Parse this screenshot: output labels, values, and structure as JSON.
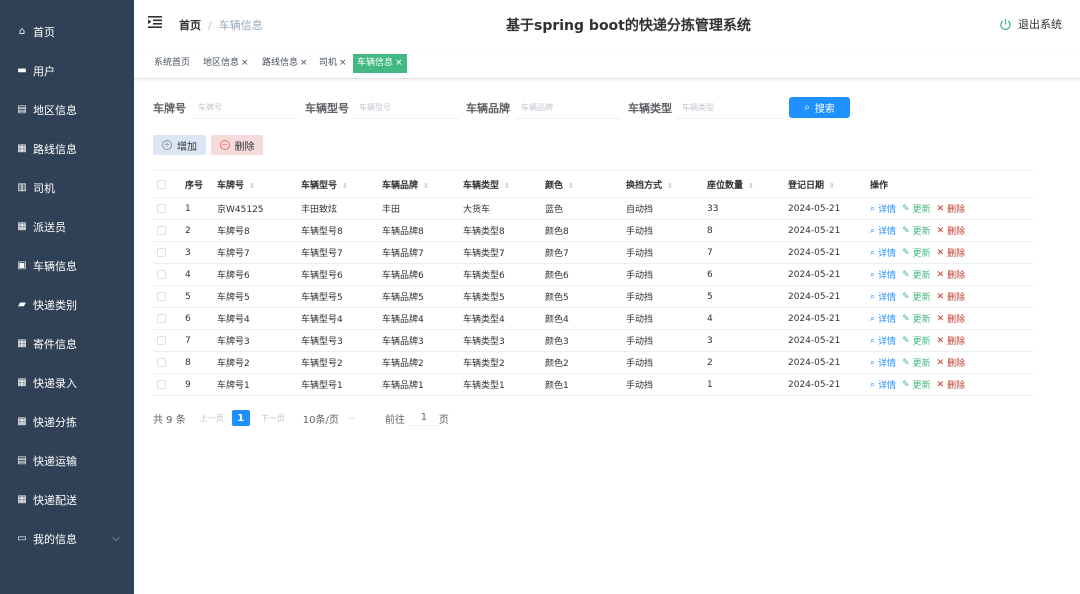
{
  "sidebar": {
    "items": [
      {
        "label": "首页",
        "icon": "home-icon",
        "glyph": "⌂"
      },
      {
        "label": "用户",
        "icon": "chat-icon",
        "glyph": "▬"
      },
      {
        "label": "地区信息",
        "icon": "clipboard-icon",
        "glyph": "▤"
      },
      {
        "label": "路线信息",
        "icon": "grid-icon",
        "glyph": "▦"
      },
      {
        "label": "司机",
        "icon": "table-icon",
        "glyph": "▥"
      },
      {
        "label": "派送员",
        "icon": "grid-icon",
        "glyph": "▦"
      },
      {
        "label": "车辆信息",
        "icon": "calendar-icon",
        "glyph": "▣"
      },
      {
        "label": "快递类别",
        "icon": "briefcase-icon",
        "glyph": "▰"
      },
      {
        "label": "寄件信息",
        "icon": "grid-icon",
        "glyph": "▦"
      },
      {
        "label": "快递录入",
        "icon": "grid-icon",
        "glyph": "▦"
      },
      {
        "label": "快递分拣",
        "icon": "grid-icon",
        "glyph": "▦"
      },
      {
        "label": "快递运输",
        "icon": "doc-icon",
        "glyph": "▤"
      },
      {
        "label": "快递配送",
        "icon": "grid-icon",
        "glyph": "▦"
      },
      {
        "label": "我的信息",
        "icon": "user-card-icon",
        "glyph": "▭"
      }
    ],
    "expand_glyph": "⌵"
  },
  "header": {
    "breadcrumb_home": "首页",
    "breadcrumb_sep": "/",
    "breadcrumb_current": "车辆信息",
    "title": "基于spring boot的快递分拣管理系统",
    "logout_label": "退出系统"
  },
  "tags": [
    {
      "label": "系统首页",
      "closable": false
    },
    {
      "label": "地区信息",
      "closable": true
    },
    {
      "label": "路线信息",
      "closable": true
    },
    {
      "label": "司机",
      "closable": true
    },
    {
      "label": "车辆信息",
      "closable": true,
      "active": true
    }
  ],
  "tag_close": "×",
  "search": {
    "fields": [
      {
        "label": "车牌号",
        "placeholder": "车牌号"
      },
      {
        "label": "车辆型号",
        "placeholder": "车辆型号"
      },
      {
        "label": "车辆品牌",
        "placeholder": "车辆品牌"
      },
      {
        "label": "车辆类型",
        "placeholder": "车辆类型"
      }
    ],
    "button_label": "搜索",
    "button_icon": "⌕"
  },
  "actions": {
    "add_label": "增加",
    "add_icon": "+",
    "delete_label": "删除",
    "delete_icon": "−"
  },
  "table": {
    "columns": [
      "序号",
      "车牌号",
      "车辆型号",
      "车辆品牌",
      "车辆类型",
      "颜色",
      "换挡方式",
      "座位数量",
      "登记日期",
      "操作"
    ],
    "sort_glyph": "⇕",
    "rows": [
      [
        "1",
        "京W45125",
        "丰田致炫",
        "丰田",
        "大货车",
        "蓝色",
        "自动挡",
        "33",
        "2024-05-21"
      ],
      [
        "2",
        "车牌号8",
        "车辆型号8",
        "车辆品牌8",
        "车辆类型8",
        "颜色8",
        "手动挡",
        "8",
        "2024-05-21"
      ],
      [
        "3",
        "车牌号7",
        "车辆型号7",
        "车辆品牌7",
        "车辆类型7",
        "颜色7",
        "手动挡",
        "7",
        "2024-05-21"
      ],
      [
        "4",
        "车牌号6",
        "车辆型号6",
        "车辆品牌6",
        "车辆类型6",
        "颜色6",
        "手动挡",
        "6",
        "2024-05-21"
      ],
      [
        "5",
        "车牌号5",
        "车辆型号5",
        "车辆品牌5",
        "车辆类型5",
        "颜色5",
        "手动挡",
        "5",
        "2024-05-21"
      ],
      [
        "6",
        "车牌号4",
        "车辆型号4",
        "车辆品牌4",
        "车辆类型4",
        "颜色4",
        "手动挡",
        "4",
        "2024-05-21"
      ],
      [
        "7",
        "车牌号3",
        "车辆型号3",
        "车辆品牌3",
        "车辆类型3",
        "颜色3",
        "手动挡",
        "3",
        "2024-05-21"
      ],
      [
        "8",
        "车牌号2",
        "车辆型号2",
        "车辆品牌2",
        "车辆类型2",
        "颜色2",
        "手动挡",
        "2",
        "2024-05-21"
      ],
      [
        "9",
        "车牌号1",
        "车辆型号1",
        "车辆品牌1",
        "车辆类型1",
        "颜色1",
        "手动挡",
        "1",
        "2024-05-21"
      ]
    ],
    "row_actions": [
      {
        "label": "详情",
        "icon": "⌕",
        "color": "blue",
        "name": "detail"
      },
      {
        "label": "更新",
        "icon": "✎",
        "color": "green",
        "name": "update"
      },
      {
        "label": "删除",
        "icon": "✕",
        "color": "red",
        "name": "delete"
      }
    ]
  },
  "pagination": {
    "total": "共 9 条",
    "prev": "上一页",
    "current": "1",
    "next": "下一页",
    "page_size": "10条/页",
    "page_size_arrow": "⌵",
    "goto_prefix": "前往",
    "goto_value": "1",
    "goto_suffix": "页"
  },
  "colors": {
    "sidebar_bg": "#304156",
    "accent_green": "#42b983",
    "primary_blue": "#1e90ff",
    "danger_red": "#c0392b"
  }
}
